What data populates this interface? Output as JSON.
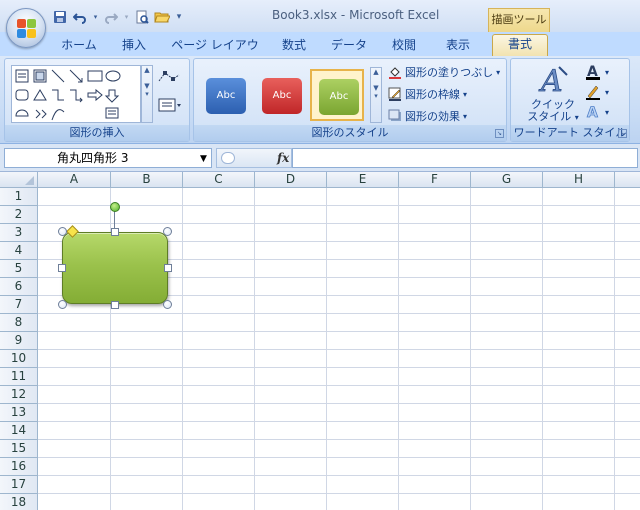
{
  "window": {
    "title": "Book3.xlsx - Microsoft Excel",
    "context_tab_group": "描画ツール"
  },
  "quick_access": {
    "icons": [
      "save-icon",
      "undo-icon",
      "redo-icon",
      "print-preview-icon",
      "open-folder-icon",
      "customize-icon"
    ]
  },
  "tabs": [
    {
      "label": "ホーム",
      "active": false
    },
    {
      "label": "挿入",
      "active": false
    },
    {
      "label": "ページ レイアウト",
      "active": false
    },
    {
      "label": "数式",
      "active": false
    },
    {
      "label": "データ",
      "active": false
    },
    {
      "label": "校閲",
      "active": false
    },
    {
      "label": "表示",
      "active": false
    },
    {
      "label": "書式",
      "active": true
    }
  ],
  "ribbon": {
    "insert_shapes": {
      "label": "図形の挿入"
    },
    "shape_styles": {
      "label": "図形のスタイル",
      "thumbs": [
        {
          "text": "Abc",
          "color": "#3a72c6"
        },
        {
          "text": "Abc",
          "color": "#d9383a"
        },
        {
          "text": "Abc",
          "color": "#8fb944",
          "selected": true
        }
      ],
      "fill_label": "図形の塗りつぶし",
      "outline_label": "図形の枠線",
      "effects_label": "図形の効果"
    },
    "wordart": {
      "label": "ワードアート スタイル",
      "quick_style_line1": "クイック",
      "quick_style_line2": "スタイル"
    }
  },
  "formula_bar": {
    "name_box": "角丸四角形 3",
    "fx": "fx",
    "formula": ""
  },
  "grid": {
    "columns": [
      "A",
      "B",
      "C",
      "D",
      "E",
      "F",
      "G",
      "H"
    ],
    "rows": [
      "1",
      "2",
      "3",
      "4",
      "5",
      "6",
      "7",
      "8",
      "9",
      "10",
      "11",
      "12",
      "13",
      "14",
      "15",
      "16",
      "17",
      "18"
    ]
  },
  "selected_shape": {
    "type": "rounded-rectangle",
    "fill_color": "#9bc24c"
  }
}
